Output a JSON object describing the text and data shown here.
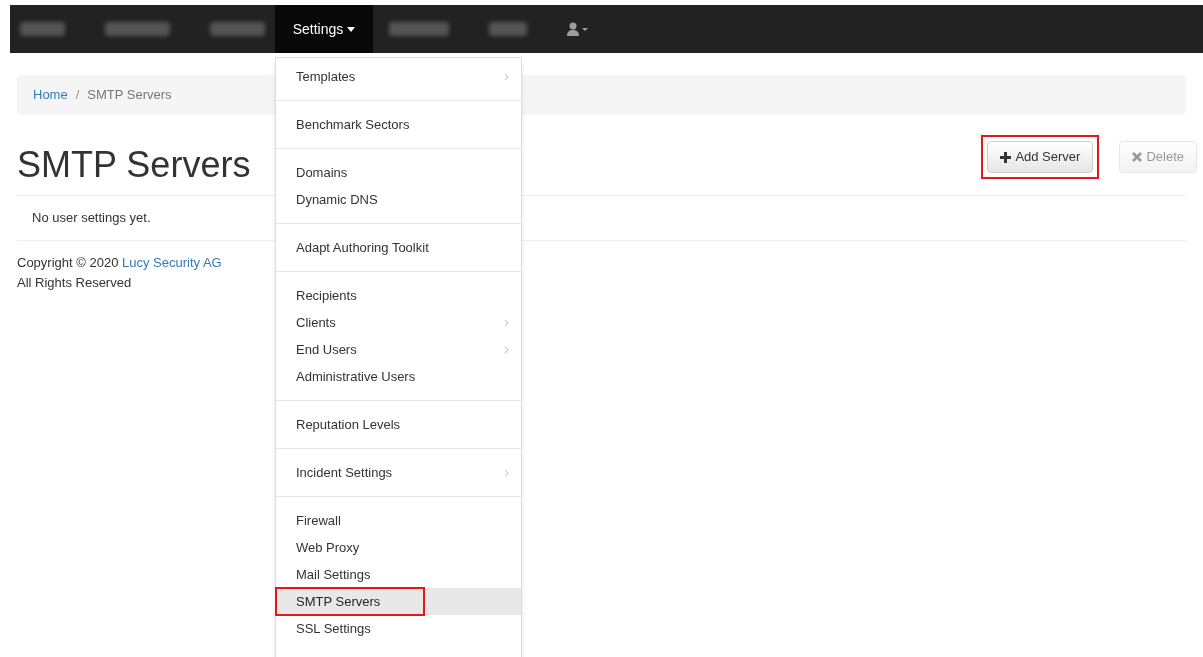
{
  "navbar": {
    "active_menu": {
      "label": "Settings",
      "expanded": true
    }
  },
  "breadcrumb": {
    "separator": "/",
    "items": [
      {
        "label": "Home",
        "link": true
      },
      {
        "label": "SMTP Servers",
        "link": false
      }
    ]
  },
  "page": {
    "title": "SMTP Servers",
    "buttons": [
      {
        "label": "Add Server",
        "kind": "add",
        "disabled": false,
        "highlighted": true
      },
      {
        "label": "Delete",
        "kind": "delete",
        "disabled": true,
        "highlighted": false
      }
    ],
    "empty_message": "No user settings yet."
  },
  "footer": {
    "copyright": "Copyright © 2020",
    "company": "Lucy Security AG",
    "rights": "All Rights Reserved"
  },
  "dropdown": {
    "groups": [
      [
        {
          "label": "Templates",
          "submenu": true,
          "selected": false,
          "highlighted": false
        }
      ],
      [
        {
          "label": "Benchmark Sectors",
          "submenu": false,
          "selected": false,
          "highlighted": false
        }
      ],
      [
        {
          "label": "Domains",
          "submenu": false,
          "selected": false,
          "highlighted": false
        },
        {
          "label": "Dynamic DNS",
          "submenu": false,
          "selected": false,
          "highlighted": false
        }
      ],
      [
        {
          "label": "Adapt Authoring Toolkit",
          "submenu": false,
          "selected": false,
          "highlighted": false
        }
      ],
      [
        {
          "label": "Recipients",
          "submenu": false,
          "selected": false,
          "highlighted": false
        },
        {
          "label": "Clients",
          "submenu": true,
          "selected": false,
          "highlighted": false
        },
        {
          "label": "End Users",
          "submenu": true,
          "selected": false,
          "highlighted": false
        },
        {
          "label": "Administrative Users",
          "submenu": false,
          "selected": false,
          "highlighted": false
        }
      ],
      [
        {
          "label": "Reputation Levels",
          "submenu": false,
          "selected": false,
          "highlighted": false
        }
      ],
      [
        {
          "label": "Incident Settings",
          "submenu": true,
          "selected": false,
          "highlighted": false
        }
      ],
      [
        {
          "label": "Firewall",
          "submenu": false,
          "selected": false,
          "highlighted": false
        },
        {
          "label": "Web Proxy",
          "submenu": false,
          "selected": false,
          "highlighted": false
        },
        {
          "label": "Mail Settings",
          "submenu": false,
          "selected": false,
          "highlighted": false
        },
        {
          "label": "SMTP Servers",
          "submenu": false,
          "selected": true,
          "highlighted": true
        },
        {
          "label": "SSL Settings",
          "submenu": false,
          "selected": false,
          "highlighted": false
        }
      ]
    ]
  }
}
